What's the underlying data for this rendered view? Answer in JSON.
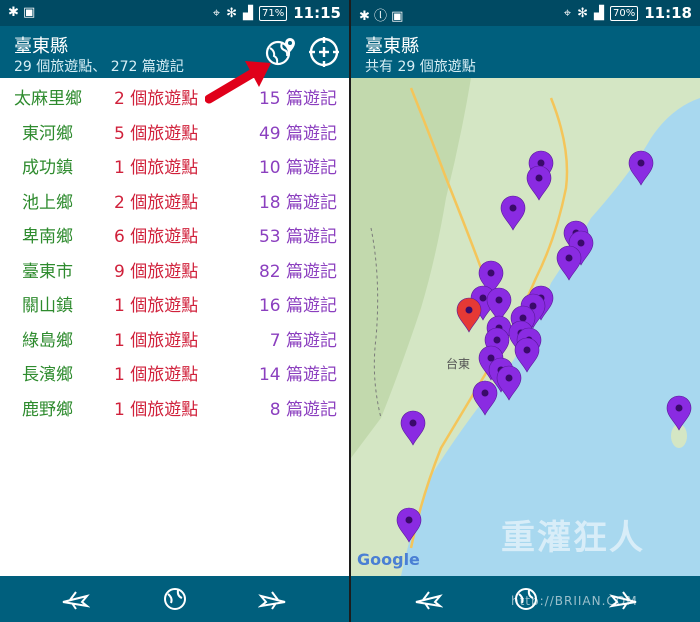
{
  "left": {
    "status": {
      "battery": "71%",
      "time": "11:15"
    },
    "header": {
      "title": "臺東縣",
      "subtitle": "29 個旅遊點、 272 篇遊記"
    },
    "rows": [
      {
        "town": "太麻里鄉",
        "spots": "2 個旅遊點",
        "notes": "15 篇遊記"
      },
      {
        "town": "東河鄉",
        "spots": "5 個旅遊點",
        "notes": "49 篇遊記"
      },
      {
        "town": "成功鎮",
        "spots": "1 個旅遊點",
        "notes": "10 篇遊記"
      },
      {
        "town": "池上鄉",
        "spots": "2 個旅遊點",
        "notes": "18 篇遊記"
      },
      {
        "town": "卑南鄉",
        "spots": "6 個旅遊點",
        "notes": "53 篇遊記"
      },
      {
        "town": "臺東市",
        "spots": "9 個旅遊點",
        "notes": "82 篇遊記"
      },
      {
        "town": "關山鎮",
        "spots": "1 個旅遊點",
        "notes": "16 篇遊記"
      },
      {
        "town": "綠島鄉",
        "spots": "1 個旅遊點",
        "notes": "7 篇遊記"
      },
      {
        "town": "長濱鄉",
        "spots": "1 個旅遊點",
        "notes": "14 篇遊記"
      },
      {
        "town": "鹿野鄉",
        "spots": "1 個旅遊點",
        "notes": "8 篇遊記"
      }
    ]
  },
  "right": {
    "status": {
      "battery": "70%",
      "time": "11:18"
    },
    "header": {
      "title": "臺東縣",
      "subtitle": "共有 29 個旅遊點"
    },
    "map": {
      "city_label": "台東",
      "google_logo": "Google"
    }
  },
  "watermark": {
    "text": "重灌狂人",
    "url": "http://BRIIAN.COM"
  },
  "colors": {
    "status_bar": "#004a63",
    "app_bar": "#005f7d",
    "town": "#2e8b2e",
    "spots": "#d0213b",
    "notes": "#8b3fbf",
    "pin_purple": "#8a2be2",
    "pin_red": "#e53935",
    "sea": "#a8d8ef",
    "land": "#d4e6c4"
  }
}
